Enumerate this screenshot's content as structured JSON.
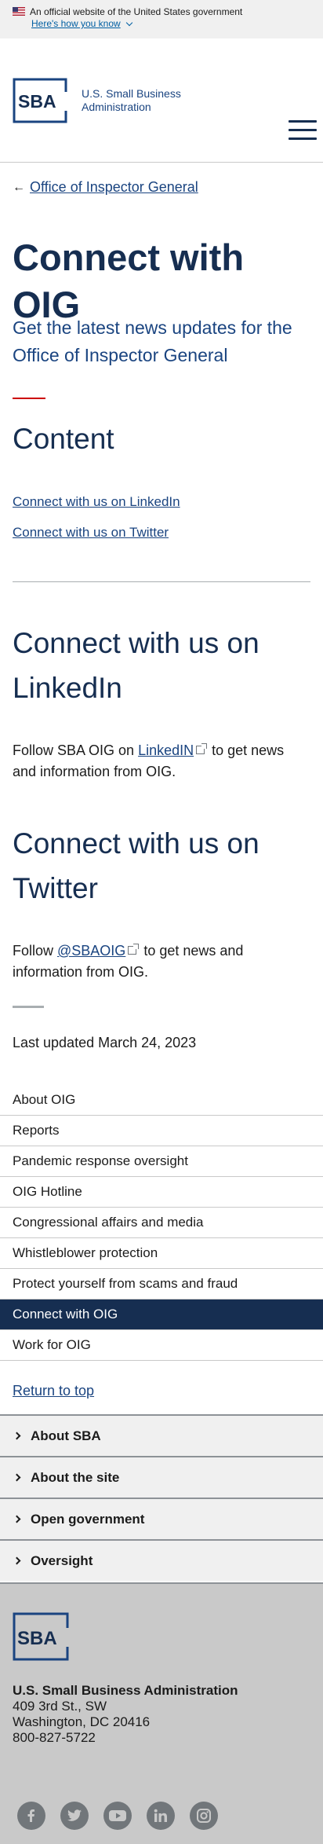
{
  "gov_banner": {
    "official_text": "An official website of the United States government",
    "how_you_know": "Here's how you know"
  },
  "header": {
    "logo_line1": "U.S. Small Business",
    "logo_line2": "Administration"
  },
  "breadcrumb": {
    "label": "Office of Inspector General"
  },
  "page": {
    "title": "Connect with OIG",
    "lead": "Get the latest news updates for the Office of Inspector General",
    "content_heading": "Content",
    "toc": [
      "Connect with us on LinkedIn",
      "Connect with us on Twitter"
    ],
    "linkedin": {
      "heading": "Connect with us on LinkedIn",
      "text_before": "Follow SBA OIG on ",
      "link": "LinkedIN",
      "text_after": " to get news and information from OIG."
    },
    "twitter": {
      "heading": "Connect with us on Twitter",
      "text_before": "Follow ",
      "link": "@SBAOIG",
      "text_after": " to get news and information from OIG."
    },
    "last_updated": "Last updated March 24, 2023"
  },
  "sidenav": {
    "items": [
      "About OIG",
      "Reports",
      "Pandemic response oversight",
      "OIG Hotline",
      "Congressional affairs and media",
      "Whistleblower protection",
      "Protect yourself from scams and fraud",
      "Connect with OIG",
      "Work for OIG"
    ],
    "active": "Connect with OIG"
  },
  "return_to_top": "Return to top",
  "accordions": [
    "About SBA",
    "About the site",
    "Open government",
    "Oversight"
  ],
  "footer": {
    "org": "U.S. Small Business Administration",
    "street": "409 3rd St., SW",
    "city": "Washington, DC 20416",
    "phone": "800-827-5722",
    "social_icons": [
      "facebook-icon",
      "twitter-icon",
      "youtube-icon",
      "linkedin-icon",
      "instagram-icon"
    ]
  },
  "colors": {
    "navy": "#162e51",
    "link": "#1a4480",
    "red": "#cc0000",
    "active_bg": "#162e51"
  }
}
